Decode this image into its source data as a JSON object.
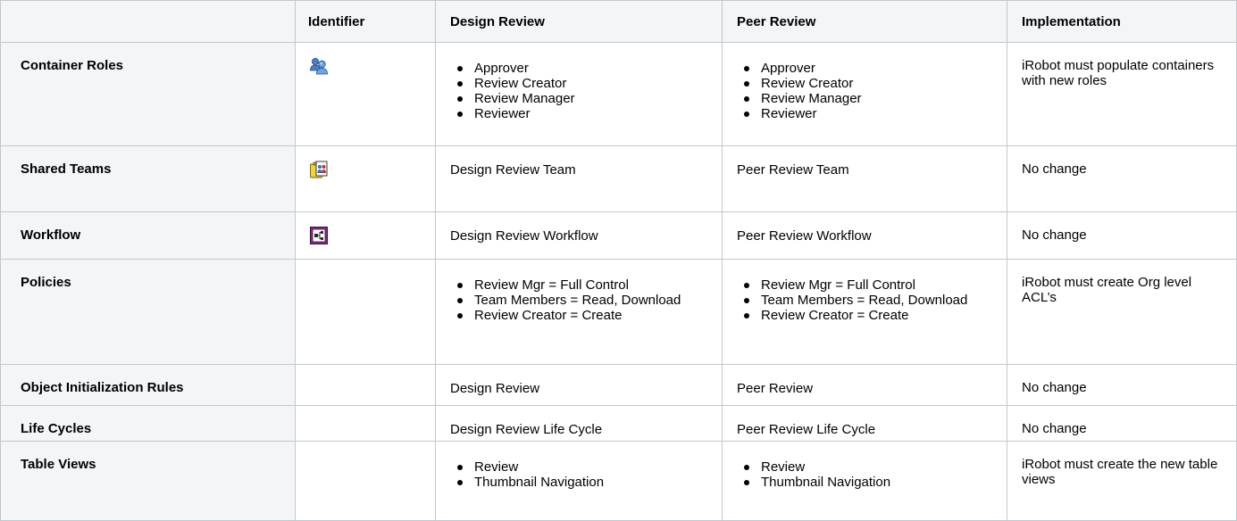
{
  "headers": {
    "corner": "",
    "identifier": "Identifier",
    "design_review": "Design Review",
    "peer_review": "Peer Review",
    "implementation": "Implementation"
  },
  "rows": {
    "container_roles": {
      "label": "Container Roles",
      "icon": "users-group-icon",
      "design_review": [
        "Approver",
        "Review Creator",
        "Review Manager",
        "Reviewer"
      ],
      "peer_review": [
        "Approver",
        "Review Creator",
        "Review Manager",
        "Reviewer"
      ],
      "implementation": "iRobot must populate containers with new roles"
    },
    "shared_teams": {
      "label": "Shared Teams",
      "icon": "shared-team-icon",
      "design_review": "Design Review Team",
      "peer_review": "Peer Review Team",
      "implementation": "No change"
    },
    "workflow": {
      "label": "Workflow",
      "icon": "workflow-icon",
      "design_review": "Design Review Workflow",
      "peer_review": "Peer Review Workflow",
      "implementation": "No change"
    },
    "policies": {
      "label": "Policies",
      "design_review": [
        "Review Mgr = Full Control",
        "Team Members = Read, Download",
        "Review Creator = Create"
      ],
      "peer_review": [
        "Review Mgr = Full Control",
        "Team Members = Read, Download",
        "Review Creator = Create"
      ],
      "implementation": "iRobot must create Org level ACL’s"
    },
    "object_init_rules": {
      "label": "Object Initialization Rules",
      "design_review": "Design Review",
      "peer_review": "Peer Review",
      "implementation": "No change"
    },
    "life_cycles": {
      "label": "Life Cycles",
      "design_review": "Design Review Life Cycle",
      "peer_review": "Peer Review Life Cycle",
      "implementation": "No change"
    },
    "table_views": {
      "label": "Table Views",
      "design_review": [
        "Review",
        "Thumbnail Navigation"
      ],
      "peer_review": [
        "Review",
        "Thumbnail Navigation"
      ],
      "implementation": "iRobot must create the new table views"
    }
  }
}
